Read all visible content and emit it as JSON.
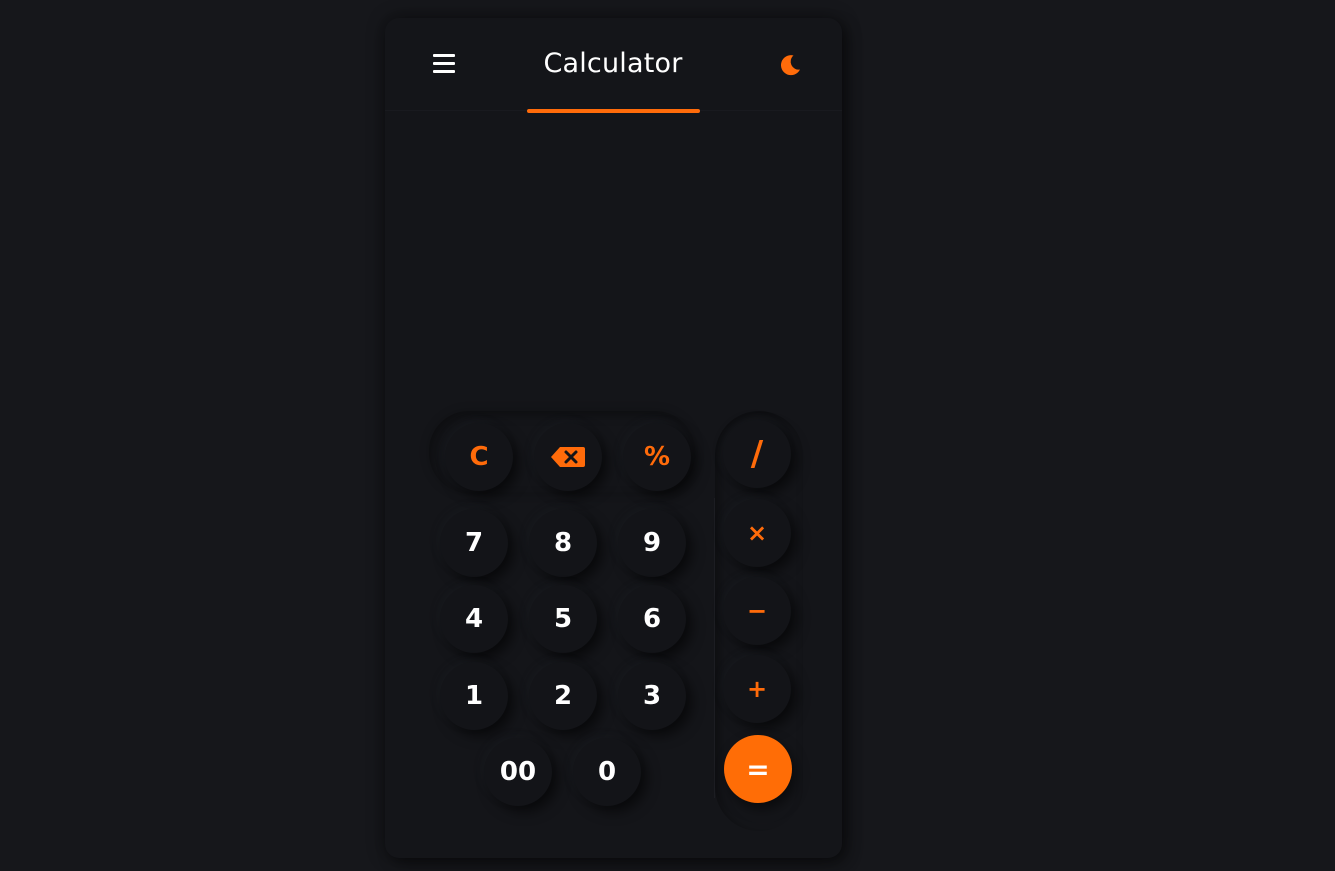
{
  "app": {
    "title": "Calculator"
  },
  "header": {
    "menu_icon": "hamburger-menu-icon",
    "theme_icon": "moon-icon"
  },
  "display": {
    "expression": "",
    "result": ""
  },
  "keypad": {
    "clear": "C",
    "backspace_icon": "backspace-icon",
    "percent": "%",
    "divide": "/",
    "multiply": "×",
    "subtract": "−",
    "add": "+",
    "equals": "=",
    "digits": {
      "d7": "7",
      "d8": "8",
      "d9": "9",
      "d4": "4",
      "d5": "5",
      "d6": "6",
      "d1": "1",
      "d2": "2",
      "d3": "3",
      "d00": "00",
      "d0": "0"
    }
  },
  "colors": {
    "accent": "#ff6b0a",
    "background": "#16171b",
    "card": "#141519",
    "text": "#ffffff"
  }
}
